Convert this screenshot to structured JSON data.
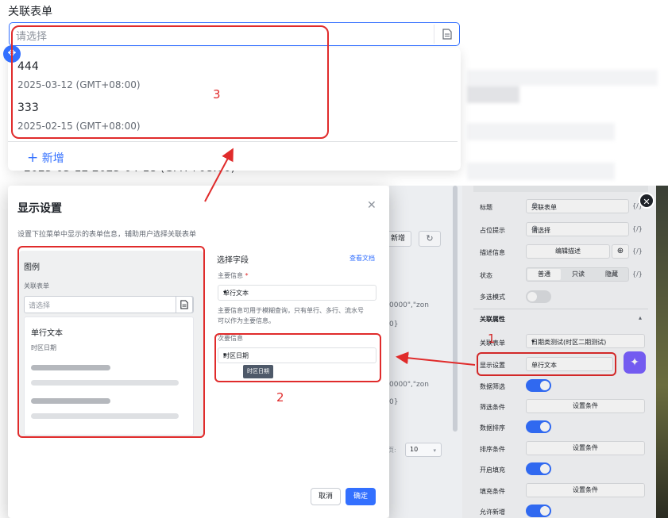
{
  "top": {
    "title": "关联表单",
    "input_placeholder": "请选择",
    "dropdown": [
      {
        "name": "444",
        "date": "2025-03-12 (GMT+08:00)"
      },
      {
        "name": "333",
        "date": "2025-02-15 (GMT+08:00)"
      }
    ],
    "add_new": "新增",
    "bg_date_text": "2025-03-12   2025-04-18 (GMT+08:00)"
  },
  "modal": {
    "title": "显示设置",
    "description": "设置下拉菜单中显示的表单信息，辅助用户选择关联表单",
    "legend": {
      "title": "图例",
      "field_label": "关联表单",
      "placeholder": "请选择",
      "item_title": "单行文本",
      "item_sub": "时区日期"
    },
    "select_field_title": "选择字段",
    "view_docs": "查看文档",
    "primary_label": "主要信息",
    "primary_required": "*",
    "primary_value": "单行文本",
    "primary_hint_1": "主要信息可用于模糊查询，只有单行、多行、流水号",
    "primary_hint_2": "可以作为主要信息。",
    "secondary_label": "次要信息",
    "secondary_value": "时区日期",
    "tooltip": "时区日期",
    "cancel": "取消",
    "confirm": "确定"
  },
  "background": {
    "new_button": "新增",
    "json_1": "0000\",\"zon",
    "json_2": "0}",
    "json_3": "0000\",\"zon",
    "json_4": "0}",
    "page_size_label": "页:",
    "page_size": "10"
  },
  "panel": {
    "title_label": "标题",
    "title_value": "关联表单",
    "placeholder_label": "占位提示",
    "placeholder_value": "请选择",
    "desc_label": "描述信息",
    "desc_button": "编辑描述",
    "state_label": "状态",
    "state_options": [
      "普通",
      "只读",
      "隐藏"
    ],
    "multi_label": "多选模式",
    "section": "关联属性",
    "assoc_label": "关联表单",
    "assoc_value": "日期类测试(时区二期测试)",
    "display_label": "显示设置",
    "display_value": "单行文本",
    "filter_label": "数据筛选",
    "filter_cond_label": "筛选条件",
    "set_cond": "设置条件",
    "sort_label": "数据排序",
    "sort_cond_label": "排序条件",
    "fill_label": "开启填充",
    "fill_cond_label": "填充条件",
    "allow_new_label": "允许新增",
    "var_token": "{/}"
  },
  "annotations": {
    "n1": "1",
    "n2": "2",
    "n3": "3"
  },
  "colors": {
    "accent": "#3370ff",
    "annotation": "#e02b2b",
    "purple": "#7b61ff"
  }
}
